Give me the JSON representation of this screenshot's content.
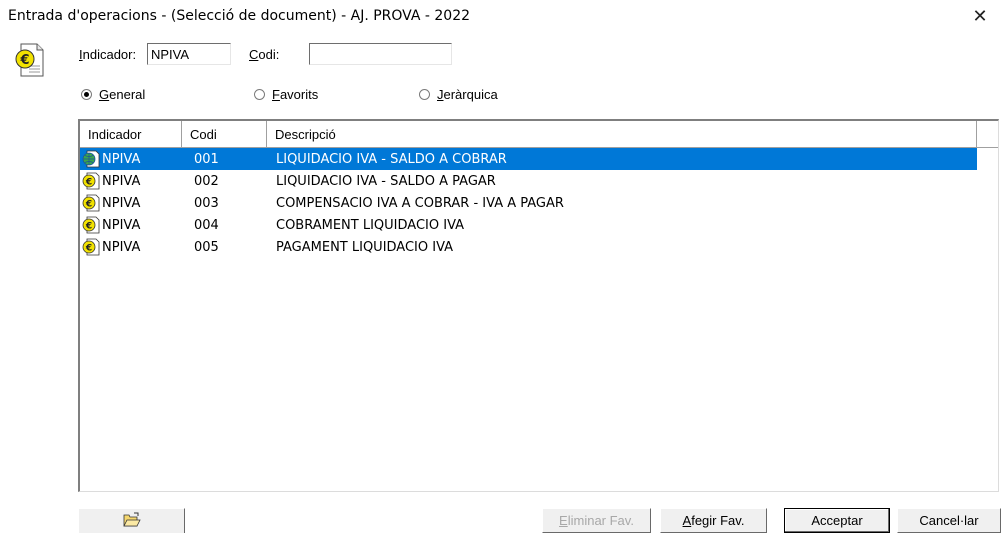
{
  "window": {
    "title": "Entrada d'operacions - (Selecció de document) - AJ. PROVA - 2022",
    "close_glyph": "✕"
  },
  "icons": {
    "app": "euro-document-icon",
    "row_selected": "globe-document-icon",
    "row": "euro-document-icon",
    "folder": "open-folder-icon"
  },
  "filters": {
    "indicador_label_underlined": "I",
    "indicador_label_rest": "ndicador:",
    "indicador_value": "NPIVA",
    "codi_label_underlined": "C",
    "codi_label_rest": "odi:",
    "codi_value": ""
  },
  "view_mode": {
    "options": [
      {
        "underlined": "G",
        "rest": "eneral",
        "selected": true
      },
      {
        "underlined": "F",
        "rest": "avorits",
        "selected": false
      },
      {
        "underlined": "J",
        "rest": "eràrquica",
        "selected": false
      }
    ]
  },
  "table": {
    "columns": [
      "Indicador",
      "Codi",
      "Descripció"
    ],
    "rows": [
      {
        "indicador": "NPIVA",
        "codi": "001",
        "descripcio": "LIQUIDACIO IVA - SALDO A COBRAR",
        "selected": true
      },
      {
        "indicador": "NPIVA",
        "codi": "002",
        "descripcio": "LIQUIDACIO IVA - SALDO A PAGAR",
        "selected": false
      },
      {
        "indicador": "NPIVA",
        "codi": "003",
        "descripcio": "COMPENSACIO IVA A COBRAR - IVA A PAGAR",
        "selected": false
      },
      {
        "indicador": "NPIVA",
        "codi": "004",
        "descripcio": "COBRAMENT LIQUIDACIO IVA",
        "selected": false
      },
      {
        "indicador": "NPIVA",
        "codi": "005",
        "descripcio": "PAGAMENT LIQUIDACIO IVA",
        "selected": false
      }
    ]
  },
  "buttons": {
    "eliminar_underlined": "E",
    "eliminar_rest": "liminar Fav.",
    "afegir_underlined": "A",
    "afegir_rest": "fegir Fav.",
    "acceptar": "Acceptar",
    "cancellar": "Cancel·lar"
  },
  "colors": {
    "selection": "#0078d7",
    "selection_text": "#ffffff",
    "disabled_text": "#a8a8a8"
  }
}
